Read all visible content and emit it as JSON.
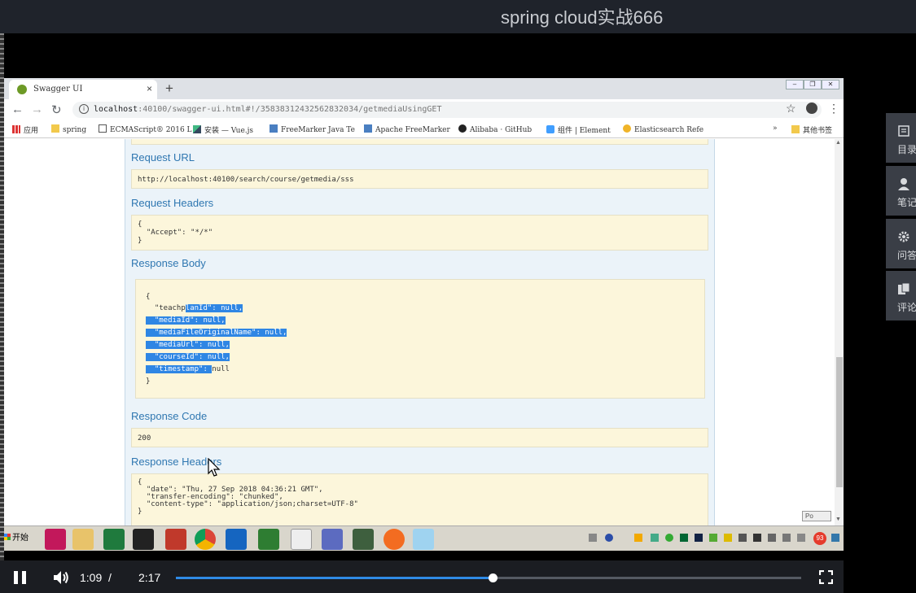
{
  "video": {
    "title": "spring cloud实战666",
    "current_time": "1:09",
    "separator": "/",
    "total_time": "2:17",
    "progress": 0.507
  },
  "browser": {
    "tab_title": "Swagger UI",
    "tab_close": "×",
    "new_tab": "+",
    "url_host": "localhost",
    "url_rest": ":40100/swagger-ui.html#!/35838312432562832034/getmediaUsingGET",
    "bookmarks": [
      {
        "label": "应用"
      },
      {
        "label": "spring"
      },
      {
        "label": "ECMAScript® 2016 L"
      },
      {
        "label": "安装 — Vue.js"
      },
      {
        "label": "FreeMarker Java Te"
      },
      {
        "label": "Apache FreeMarker"
      },
      {
        "label": "Alibaba · GitHub"
      },
      {
        "label": "组件 | Element"
      },
      {
        "label": "Elasticsearch Refe"
      },
      {
        "label": "»"
      },
      {
        "label": "其他书签"
      }
    ]
  },
  "swagger": {
    "request_url_title": "Request URL",
    "request_url": "http://localhost:40100/search/course/getmedia/sss",
    "request_headers_title": "Request Headers",
    "request_headers": [
      "{",
      "  \"Accept\": \"*/*\"",
      "}"
    ],
    "response_body_title": "Response Body",
    "response_body": {
      "open": "{",
      "close": "}",
      "fields": [
        {
          "pre": "  \"teachp",
          "sel": "lanId\": null,",
          "post": ""
        },
        {
          "pre": "",
          "sel": "  \"mediaId\": null,",
          "post": ""
        },
        {
          "pre": "",
          "sel": "  \"mediaFileOriginalName\": null,",
          "post": ""
        },
        {
          "pre": "",
          "sel": "  \"mediaUrl\": null,",
          "post": ""
        },
        {
          "pre": "",
          "sel": "  \"courseId\": null,",
          "post": ""
        },
        {
          "pre": "",
          "sel": "  \"timestamp\": ",
          "post": "null"
        }
      ]
    },
    "response_code_title": "Response Code",
    "response_code": "200",
    "response_headers_title": "Response Headers",
    "response_headers": [
      "{",
      "  \"date\": \"Thu, 27 Sep 2018 04:36:21 GMT\",",
      "  \"transfer-encoding\": \"chunked\",",
      "  \"content-type\": \"application/json;charset=UTF-8\"",
      "}"
    ]
  },
  "taskbar": {
    "start_label": "开始",
    "badge": "93",
    "ime_label": "Po"
  },
  "side_panel": [
    {
      "label": "目录",
      "icon": "list-icon"
    },
    {
      "label": "笔记",
      "icon": "user-icon"
    },
    {
      "label": "问答",
      "icon": "gear-icon"
    },
    {
      "label": "评论",
      "icon": "copy-icon"
    }
  ]
}
